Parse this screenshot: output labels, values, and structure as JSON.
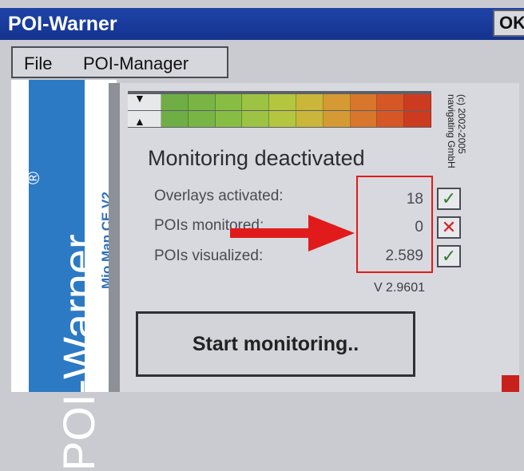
{
  "window": {
    "title": "POI-Warner",
    "ok_label": "OK"
  },
  "menu": {
    "items": [
      {
        "label": "File"
      },
      {
        "label": "POI-Manager"
      }
    ]
  },
  "sidebar": {
    "brand": "POI-Warner",
    "registered_mark": "®",
    "product": "Mio Map CE V2"
  },
  "meter": {
    "colors": [
      "#6fae44",
      "#78b545",
      "#88bd44",
      "#9cc343",
      "#b4c63f",
      "#c9b63a",
      "#d59a33",
      "#d8762b",
      "#d65725",
      "#cc3a1f"
    ],
    "marker_icon": "triangle-icon"
  },
  "copyright": {
    "line1": "(c) 2002-2005",
    "line2": "navigating GmbH"
  },
  "status": {
    "title": "Monitoring deactivated",
    "rows": [
      {
        "label": "Overlays activated:",
        "value": "18",
        "state": "ok"
      },
      {
        "label": "POIs monitored:",
        "value": "0",
        "state": "off"
      },
      {
        "label": "POIs visualized:",
        "value": "2.589",
        "state": "ok"
      }
    ]
  },
  "icons": {
    "check": "✓",
    "cross": "✕",
    "marker_down": "▼",
    "marker_up": "▲"
  },
  "version": "V 2.9601",
  "actions": {
    "start_label": "Start monitoring.."
  },
  "annotation": {
    "color": "#e11b1b"
  }
}
